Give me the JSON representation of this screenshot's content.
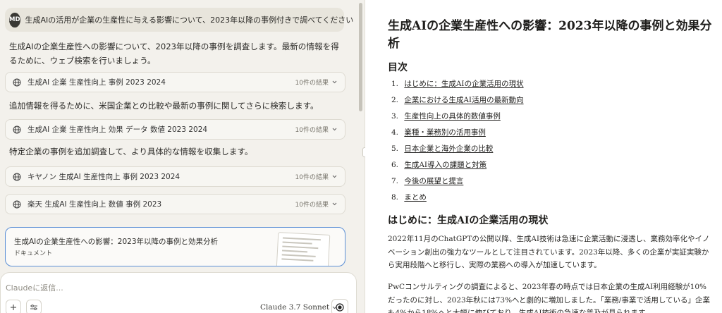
{
  "chat": {
    "user_message": {
      "avatar_initials": "MD",
      "text": "生成AIの活用が企業の生産性に与える影響について、2023年以降の事例付きで調べてください"
    },
    "assistant_texts": [
      "生成AIの企業生産性への影響について、2023年以降の事例を調査します。最新の情報を得るために、ウェブ検索を行いましょう。",
      "追加情報を得るために、米国企業との比較や最新の事例に関してさらに検索します。",
      "特定企業の事例を追加調査して、より具体的な情報を収集します。"
    ],
    "searches": [
      {
        "query": "生成AI 企業 生産性向上 事例 2023 2024",
        "count": "10件の結果"
      },
      {
        "query": "生成AI 企業 生産性向上 効果 データ 数値 2023 2024",
        "count": "10件の結果"
      },
      {
        "query": "キヤノン 生成AI 生産性向上 事例 2023 2024",
        "count": "10件の結果"
      },
      {
        "query": "楽天 生成AI 生産性向上 数値 事例 2023",
        "count": "10件の結果"
      }
    ],
    "document_card": {
      "title": "生成AIの企業生産性への影響：2023年以降の事例と効果分析",
      "type": "ドキュメント"
    },
    "composer": {
      "placeholder": "Claudeに返信...",
      "model": "Claude 3.7 Sonnet"
    }
  },
  "artifact": {
    "title": "生成AIの企業生産性への影響：2023年以降の事例と効果分析",
    "toc_heading": "目次",
    "toc": [
      {
        "num": "1.",
        "label": "はじめに：生成AIの企業活用の現状"
      },
      {
        "num": "2.",
        "label": "企業における生成AI活用の最新動向"
      },
      {
        "num": "3.",
        "label": "生産性向上の具体的数値事例"
      },
      {
        "num": "4.",
        "label": "業種・業務別の活用事例"
      },
      {
        "num": "5.",
        "label": "日本企業と海外企業の比較"
      },
      {
        "num": "6.",
        "label": "生成AI導入の課題と対策"
      },
      {
        "num": "7.",
        "label": "今後の展望と提言"
      },
      {
        "num": "8.",
        "label": "まとめ"
      }
    ],
    "section_heading": "はじめに：生成AIの企業活用の現状",
    "paragraphs": [
      "2022年11月のChatGPTの公開以降、生成AI技術は急速に企業活動に浸透し、業務効率化やイノベーション創出の強力なツールとして注目されています。2023年以降、多くの企業が実証実験から実用段階へと移行し、実際の業務への導入が加速しています。",
      "PwCコンサルティングの調査によると、2023年春の時点では日本企業の生成AI利用経験が10%だったのに対し、2023年秋には73%へと劇的に増加しました。「業務/事業で活用している」企業も4%から18%へと大幅に伸びており、生成AI技術の急速な普及が見られます。"
    ]
  }
}
